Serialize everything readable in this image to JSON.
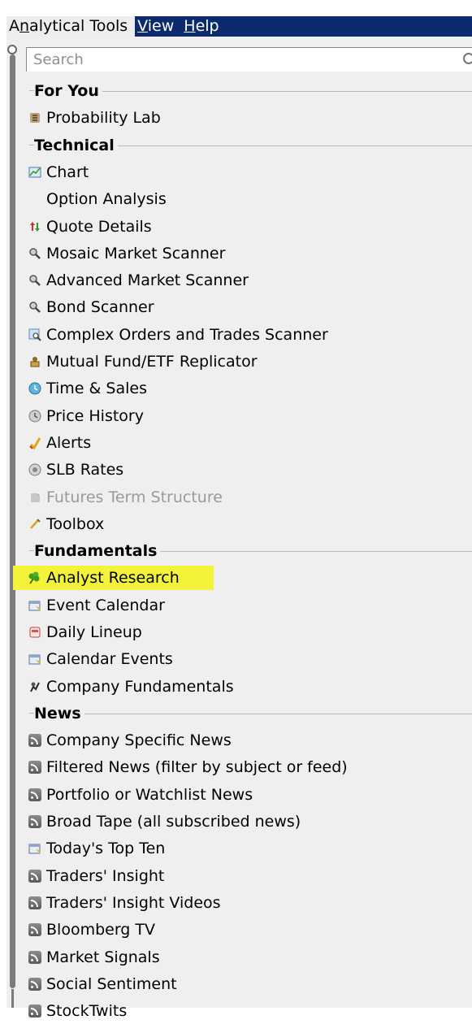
{
  "menubar": {
    "items": [
      {
        "label_pre": "A",
        "mnemonic": "n",
        "label_post": "alytical Tools"
      },
      {
        "label_pre": "",
        "mnemonic": "V",
        "label_post": "iew"
      },
      {
        "label_pre": "",
        "mnemonic": "H",
        "label_post": "elp"
      }
    ]
  },
  "search": {
    "placeholder": "Search",
    "value": ""
  },
  "sections": [
    {
      "title": "For You",
      "items": [
        {
          "label": "Probability Lab",
          "icon": "probability-lab-icon"
        }
      ]
    },
    {
      "title": "Technical",
      "items": [
        {
          "label": "Chart",
          "icon": "chart-icon"
        },
        {
          "label": "Option Analysis",
          "icon": ""
        },
        {
          "label": "Quote Details",
          "icon": "up-down-arrows-icon"
        },
        {
          "label": "Mosaic Market Scanner",
          "icon": "scanner-icon"
        },
        {
          "label": "Advanced Market Scanner",
          "icon": "scanner-icon"
        },
        {
          "label": "Bond Scanner",
          "icon": "scanner-icon"
        },
        {
          "label": "Complex Orders and Trades Scanner",
          "icon": "complex-scanner-icon"
        },
        {
          "label": "Mutual Fund/ETF Replicator",
          "icon": "replicator-icon"
        },
        {
          "label": "Time & Sales",
          "icon": "time-sales-icon"
        },
        {
          "label": "Price History",
          "icon": "price-history-icon"
        },
        {
          "label": "Alerts",
          "icon": "alert-icon"
        },
        {
          "label": "SLB Rates",
          "icon": "slb-rates-icon"
        },
        {
          "label": "Futures Term Structure",
          "icon": "futures-icon",
          "disabled": true
        },
        {
          "label": "Toolbox",
          "icon": "toolbox-icon"
        }
      ]
    },
    {
      "title": "Fundamentals",
      "items": [
        {
          "label": "Analyst Research",
          "icon": "clover-icon",
          "highlighted": true
        },
        {
          "label": "Event Calendar",
          "icon": "calendar-icon"
        },
        {
          "label": "Daily Lineup",
          "icon": "daily-lineup-icon"
        },
        {
          "label": "Calendar Events",
          "icon": "calendar-icon"
        },
        {
          "label": "Company Fundamentals",
          "icon": "fundamentals-icon"
        }
      ]
    },
    {
      "title": "News",
      "items": [
        {
          "label": "Company Specific News",
          "icon": "rss-icon"
        },
        {
          "label": "Filtered News (filter by subject or feed)",
          "icon": "rss-icon"
        },
        {
          "label": "Portfolio or Watchlist News",
          "icon": "rss-icon"
        },
        {
          "label": "Broad Tape (all subscribed news)",
          "icon": "rss-icon"
        },
        {
          "label": "Today's Top Ten",
          "icon": "calendar-icon"
        },
        {
          "label": "Traders' Insight",
          "icon": "rss-icon"
        },
        {
          "label": "Traders' Insight Videos",
          "icon": "rss-icon"
        },
        {
          "label": "Bloomberg TV",
          "icon": "rss-icon"
        },
        {
          "label": "Market Signals",
          "icon": "rss-icon"
        },
        {
          "label": "Social Sentiment",
          "icon": "rss-icon"
        },
        {
          "label": "StockTwits",
          "icon": "rss-icon"
        }
      ]
    }
  ]
}
